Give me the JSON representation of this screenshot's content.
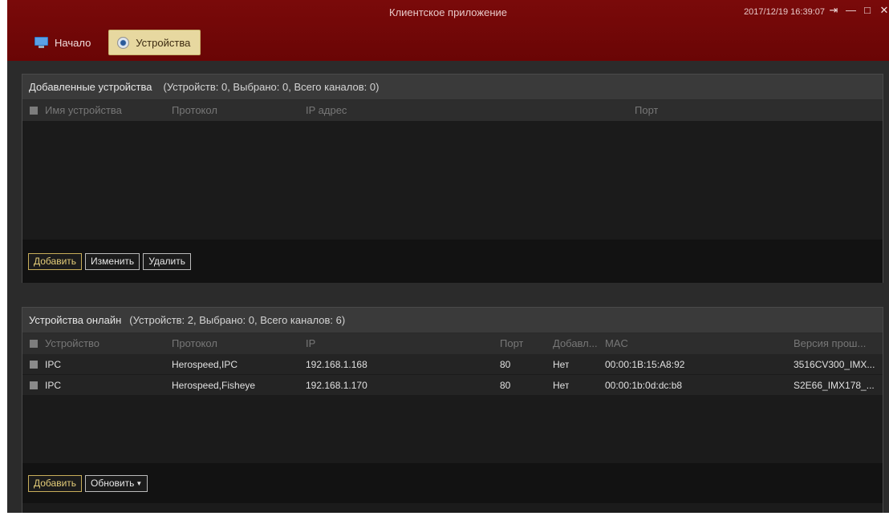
{
  "window": {
    "title": "Клиентское приложение",
    "clock": "2017/12/19 16:39:07",
    "logout_glyph": "⇥",
    "minimize_glyph": "—",
    "maximize_glyph": "□",
    "close_glyph": "✕"
  },
  "nav": {
    "home_label": "Начало",
    "devices_label": "Устройства",
    "active": "devices"
  },
  "added_devices": {
    "title": "Добавленные устройства",
    "summary": "(Устройств: 0, Выбрано: 0, Всего каналов: 0)",
    "columns": [
      "Имя устройства",
      "Протокол",
      "IP адрес",
      "Порт"
    ],
    "rows": [],
    "buttons": {
      "add": "Добавить",
      "edit": "Изменить",
      "delete": "Удалить"
    }
  },
  "online_devices": {
    "title": "Устройства онлайн",
    "summary": "(Устройств: 2, Выбрано: 0, Всего каналов: 6)",
    "columns": [
      "Устройство",
      "Протокол",
      "IP",
      "Порт",
      "Добавл...",
      "MAC",
      "Версия прош..."
    ],
    "rows": [
      {
        "device": "IPC",
        "protocol": "Herospeed,IPC",
        "ip": "192.168.1.168",
        "port": "80",
        "added": "Нет",
        "mac": "00:00:1B:15:A8:92",
        "firmware": "3516CV300_IMX..."
      },
      {
        "device": "IPC",
        "protocol": "Herospeed,Fisheye",
        "ip": "192.168.1.170",
        "port": "80",
        "added": "Нет",
        "mac": "00:00:1b:0d:dc:b8",
        "firmware": "S2E66_IMX178_..."
      }
    ],
    "buttons": {
      "add": "Добавить",
      "refresh": "Обновить"
    }
  },
  "colors": {
    "header": "#6e0707",
    "panel_bg": "#1b1b1b",
    "accent": "#e4cd79"
  }
}
